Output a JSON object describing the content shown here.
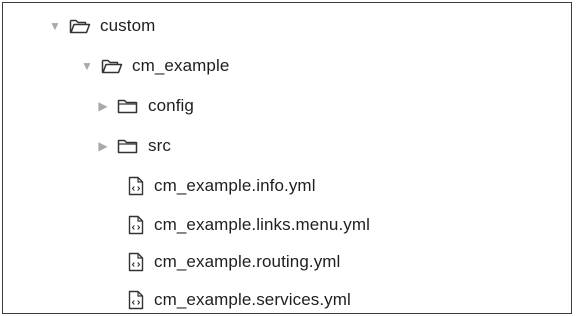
{
  "tree": {
    "items": [
      {
        "label": "custom",
        "kind": "folder",
        "state": "expanded",
        "icon": "folder-open-icon"
      },
      {
        "label": "cm_example",
        "kind": "folder",
        "state": "expanded",
        "icon": "folder-open-icon"
      },
      {
        "label": "config",
        "kind": "folder",
        "state": "collapsed",
        "icon": "folder-icon"
      },
      {
        "label": "src",
        "kind": "folder",
        "state": "collapsed",
        "icon": "folder-icon"
      },
      {
        "label": "cm_example.info.yml",
        "kind": "file",
        "icon": "code-file-icon"
      },
      {
        "label": "cm_example.links.menu.yml",
        "kind": "file",
        "icon": "code-file-icon"
      },
      {
        "label": "cm_example.routing.yml",
        "kind": "file",
        "icon": "code-file-icon"
      },
      {
        "label": "cm_example.services.yml",
        "kind": "file",
        "icon": "code-file-icon"
      }
    ]
  },
  "colors": {
    "border": "#3c3c3c",
    "disclosure_triangle": "#a9a9a9",
    "icon_stroke": "#333333",
    "text": "#1f1f1f"
  }
}
